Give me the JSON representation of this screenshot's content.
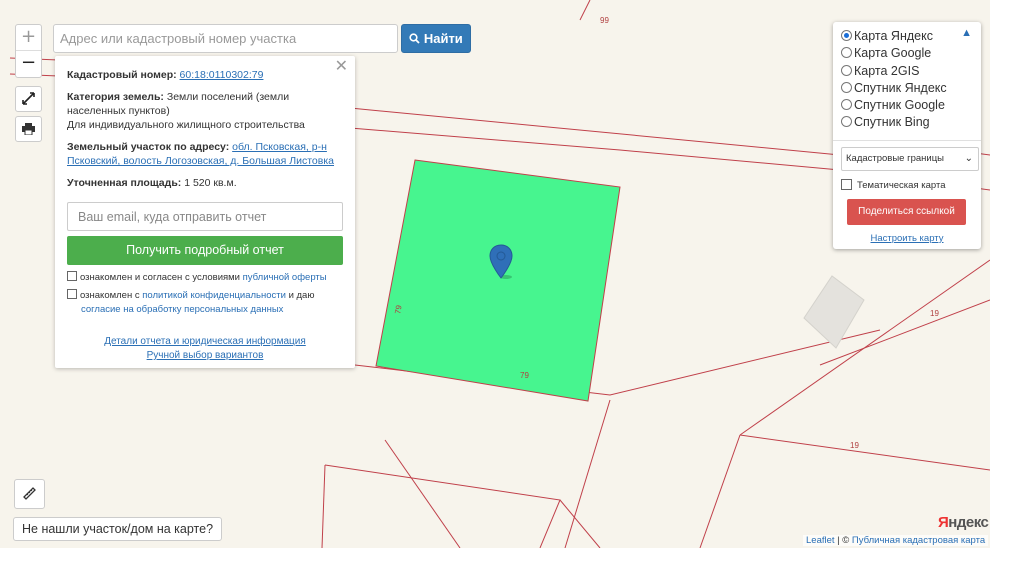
{
  "search": {
    "placeholder": "Адрес или кадастровый номер участка",
    "button_label": "Найти"
  },
  "controls": {
    "zoom_in": "+",
    "zoom_out": "−"
  },
  "parcel_popup": {
    "cadastral_label": "Кадастровый номер:",
    "cadastral_number": "60:18:0110302:79",
    "category_label": "Категория земель:",
    "category_value": "Земли поселений (земли населенных пунктов)",
    "usage": "Для индивидуального жилищного строительства",
    "address_label": "Земельный участок по адресу:",
    "address_link": "обл. Псковская, р-н Псковский, волость Логозовская, д. Большая Листовка",
    "area_label": "Уточненная площадь:",
    "area_value": "1 520 кв.м.",
    "email_placeholder": "Ваш email, куда отправить отчет",
    "report_button": "Получить подробный отчет",
    "consent1_text": "ознакомлен и согласен с условиями",
    "consent1_link": "публичной оферты",
    "consent2_text": "ознакомлен с",
    "consent2_link": "политикой конфиденциальности",
    "consent2_mid": "и даю",
    "consent2_link2": "согласие на обработку персональных данных",
    "details_link": "Детали отчета и юридическая информация",
    "manual_link": "Ручной выбор вариантов"
  },
  "layers_panel": {
    "options": [
      {
        "label": "Карта Яндекс",
        "selected": true
      },
      {
        "label": "Карта Google",
        "selected": false
      },
      {
        "label": "Карта 2GIS",
        "selected": false
      },
      {
        "label": "Спутник Яндекс",
        "selected": false
      },
      {
        "label": "Спутник Google",
        "selected": false
      },
      {
        "label": "Спутник Bing",
        "selected": false
      }
    ],
    "overlay_select": "Кадастровые границы",
    "thematic_label": "Тематическая карта",
    "thematic_checked": false,
    "share_button": "Поделиться ссылкой",
    "settings_link": "Настроить карту"
  },
  "map": {
    "plot_numbers": {
      "top": "99",
      "parcel_side": "79",
      "parcel_bottom": "79",
      "right_upper": "19",
      "right_lower": "19"
    },
    "parcel_color": "#47f58f",
    "boundary_color": "#c0404a",
    "marker_color": "#2f6fb8",
    "logo": "Яндекс"
  },
  "bottom": {
    "not_found": "Не нашли участок/дом на карте?"
  },
  "attribution": {
    "leaflet": "Leaflet",
    "separator": " | © ",
    "source": "Публичная кадастровая карта"
  }
}
